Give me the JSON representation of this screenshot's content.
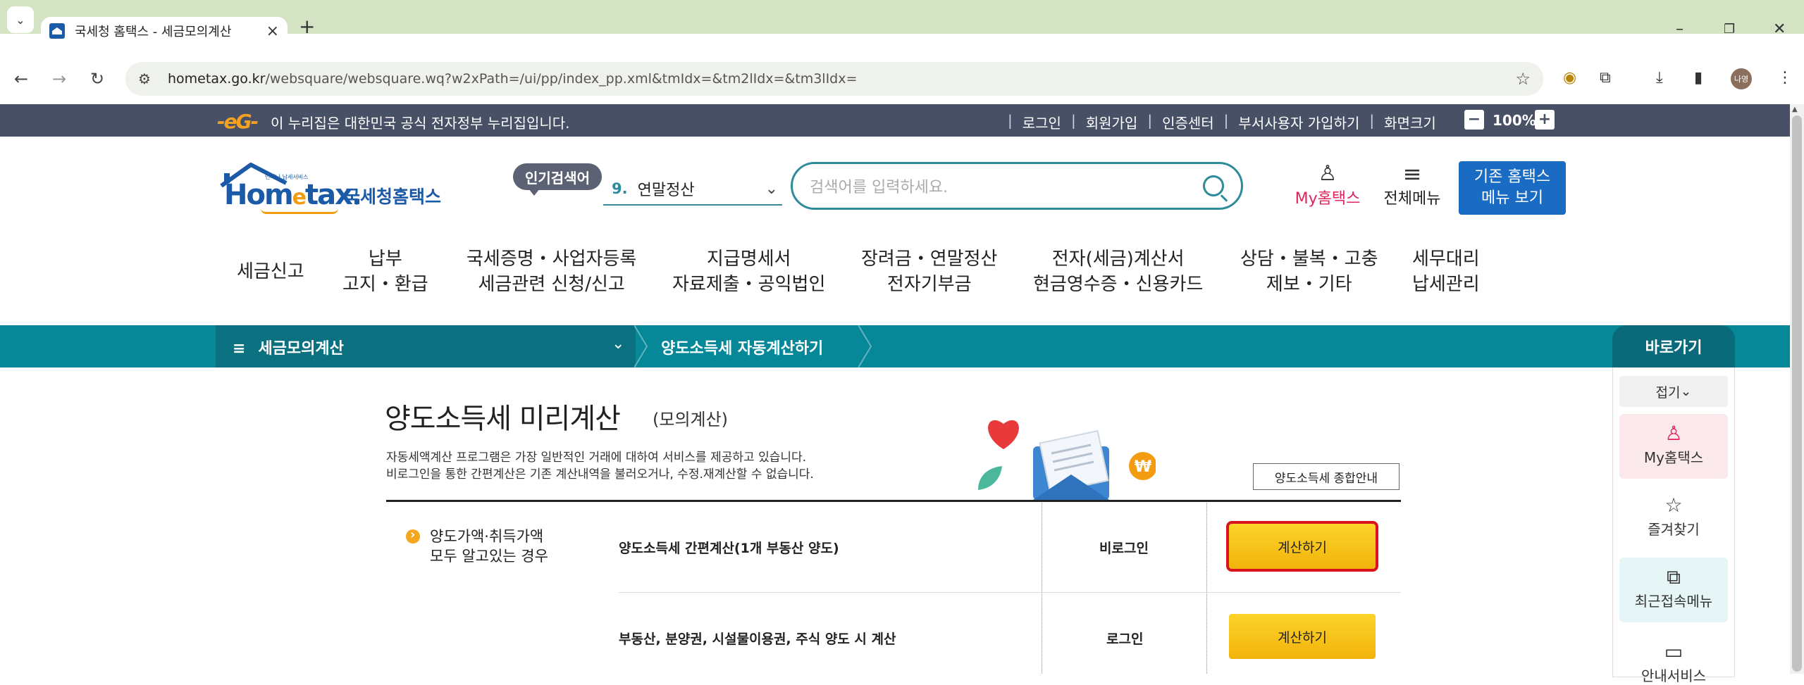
{
  "browser": {
    "tab_title": "국세청 홈택스 - 세금모의계산",
    "url_host": "hometax.go.kr",
    "url_path": "/websquare/websquare.wq?w2xPath=/ui/pp/index_pp.xml&tmIdx=&tm2lIdx=&tm3lIdx=",
    "avatar_text": "나영"
  },
  "gov_banner": {
    "text": "이 누리집은 대한민국 공식 전자정부 누리집입니다.",
    "links": [
      "로그인",
      "회원가입",
      "인증센터",
      "부서사용자 가입하기",
      "화면크기"
    ],
    "zoom": "100%",
    "zoom_minus": "−",
    "zoom_plus": "+"
  },
  "header": {
    "logo_small": "언제나 납세서비스",
    "logo_main_pre": "Hom",
    "logo_main_e": "e",
    "logo_main_post": "tax.",
    "logo_kor": "국세청홈택스",
    "popular_badge": "인기검색어",
    "popular_rank": "9.",
    "popular_term": "연말정산",
    "search_placeholder": "검색어를 입력하세요.",
    "my_hometax": "My홈택스",
    "all_menu": "전체메뉴",
    "old_hometax_line1": "기존 홈택스",
    "old_hometax_line2": "메뉴 보기"
  },
  "gnb": [
    {
      "l1": "세금신고",
      "l2": ""
    },
    {
      "l1": "납부",
      "l2": "고지・환급"
    },
    {
      "l1": "국세증명・사업자등록",
      "l2": "세금관련 신청/신고"
    },
    {
      "l1": "지급명세서",
      "l2": "자료제출・공익법인"
    },
    {
      "l1": "장려금・연말정산",
      "l2": "전자기부금"
    },
    {
      "l1": "전자(세금)계산서",
      "l2": "현금영수증・신용카드"
    },
    {
      "l1": "상담・불복・고충",
      "l2": "제보・기타"
    },
    {
      "l1": "세무대리",
      "l2": "납세관리"
    }
  ],
  "breadcrumb": {
    "home": "세금모의계산",
    "current": "양도소득세 자동계산하기"
  },
  "quick_menu": {
    "title": "바로가기",
    "fold": "접기",
    "items": [
      "My홈택스",
      "즐겨찾기",
      "최근접속메뉴",
      "안내서비스"
    ]
  },
  "content": {
    "title": "양도소득세 미리계산",
    "subtitle": "(모의계산)",
    "desc1": "자동세액계산 프로그램은 가장 일반적인 거래에 대하여 서비스를 제공하고 있습니다.",
    "desc2": "비로그인을 통한 간편계산은 기존 계산내역을 불러오거나, 수정.재계산할 수 없습니다.",
    "guide_button": "양도소득세 종합안내",
    "section_line1": "양도가액·취득가액",
    "section_line2": "모두 알고있는 경우",
    "rows": [
      {
        "label": "양도소득세 간편계산(1개 부동산 양도)",
        "login": "비로그인",
        "button": "계산하기"
      },
      {
        "label": "부동산, 분양권, 시설물이용권, 주식 양도 시 계산",
        "login": "로그인",
        "button": "계산하기"
      }
    ]
  },
  "colors": {
    "gov_bar": "#485066",
    "breadcrumb_bar": "#078899",
    "brand_blue": "#1b5aa6",
    "calc_button": "#f8c419",
    "highlight": "#d8141d"
  }
}
